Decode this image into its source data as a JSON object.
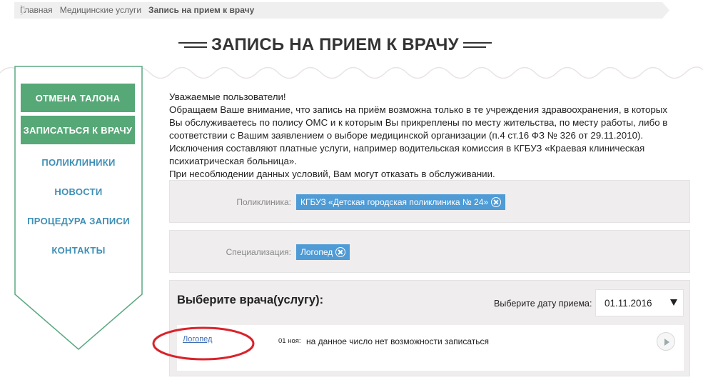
{
  "breadcrumb": {
    "items": [
      "Главная",
      "Медицинские услуги",
      "Запись на прием к врачу"
    ]
  },
  "page": {
    "title": "ЗАПИСЬ НА ПРИЕМ К ВРАЧУ"
  },
  "sidebar": {
    "buttons": [
      "ОТМЕНА ТАЛОНА",
      "ЗАПИСАТЬСЯ К ВРАЧУ"
    ],
    "links": [
      "ПОЛИКЛИНИКИ",
      "НОВОСТИ",
      "ПРОЦЕДУРА ЗАПИСИ",
      "КОНТАКТЫ"
    ]
  },
  "intro": {
    "lines": [
      "Уважаемые пользователи!",
      "Обращаем Ваше внимание, что запись на приём возможна только в те учреждения здравоохранения, в которых Вы обслуживаетесь по полису ОМС и к которым Вы прикреплены по месту жительства, по месту работы, либо в соответствии с Вашим заявлением о выборе медицинской организации (п.4 ст.16 ФЗ № 326 от 29.11.2010). Исключения составляют платные услуги, например водительская комиссия в КГБУЗ «Краевая клиническая психиатрическая больница».",
      "При несоблюдении данных условий, Вам могут отказать в обслуживании."
    ]
  },
  "filters": {
    "clinic_label": "Поликлиника:",
    "clinic_value": "КГБУЗ «Детская городская поликлиника № 24»",
    "spec_label": "Специализация:",
    "spec_value": "Логопед"
  },
  "doctors": {
    "title": "Выберите врача(услугу):",
    "date_label": "Выберите дату приема:",
    "date_value": "01.11.2016",
    "rows": [
      {
        "name": "Логопед",
        "date": "01 ноя:",
        "status": "на данное число нет возможности записаться"
      }
    ]
  },
  "colors": {
    "accent_green": "#56a877",
    "link_blue": "#3f8fb6",
    "tag_blue": "#4e9bd6",
    "annotation_red": "#d9232b"
  }
}
